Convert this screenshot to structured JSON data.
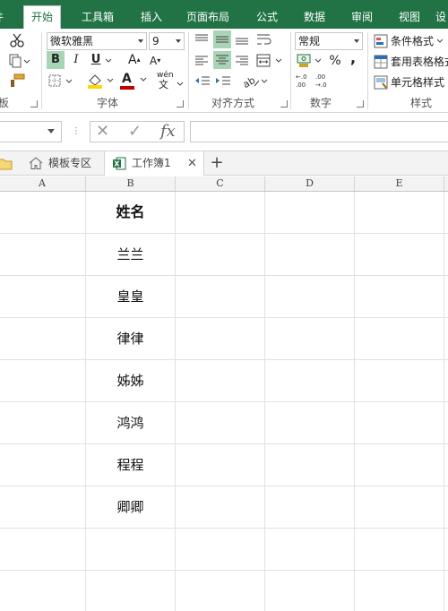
{
  "ribbon_tabs": [
    "开始",
    "工具箱",
    "插入",
    "页面布局",
    "公式",
    "数据",
    "审阅",
    "视图"
  ],
  "active_tab": "开始",
  "clipboard": {
    "group_label": "板"
  },
  "font": {
    "name": "微软雅黑",
    "size": "9",
    "bold": "B",
    "italic": "I",
    "underline": "U",
    "grow": "A",
    "shrink": "A",
    "wen": "wén",
    "wen_char": "文",
    "font_color_letter": "A",
    "group_label": "字体"
  },
  "alignment": {
    "group_label": "对齐方式"
  },
  "number": {
    "format": "常规",
    "percent": "%",
    "comma": ",",
    "inc_decimal": "←.0\n.00",
    "dec_decimal": ".00\n→.0",
    "group_label": "数字"
  },
  "styles": {
    "conditional": "条件格式",
    "table": "套用表格格式",
    "cell": "单元格样式",
    "group_label": "样式"
  },
  "formula_bar": {
    "name_box": "",
    "cancel": "✕",
    "enter": "✓",
    "fx": "fx",
    "content": ""
  },
  "workbook_tabs": [
    {
      "label": "模板专区"
    },
    {
      "label": "工作簿1"
    }
  ],
  "add_tab": "+",
  "close_tab": "✕",
  "columns": [
    "A",
    "B",
    "C",
    "D",
    "E"
  ],
  "rows": [
    {
      "b": "姓名",
      "header": true
    },
    {
      "b": "兰兰"
    },
    {
      "b": "皇皇"
    },
    {
      "b": "律律"
    },
    {
      "b": "姊姊"
    },
    {
      "b": "鸿鸿"
    },
    {
      "b": "程程"
    },
    {
      "b": "卿卿"
    },
    {
      "b": ""
    },
    {
      "b": ""
    }
  ],
  "colors": {
    "accent": "#217346",
    "highlight": "#a8d5b5",
    "font_color_bar": "#c00000",
    "fill_color_bar": "#ffd700"
  }
}
